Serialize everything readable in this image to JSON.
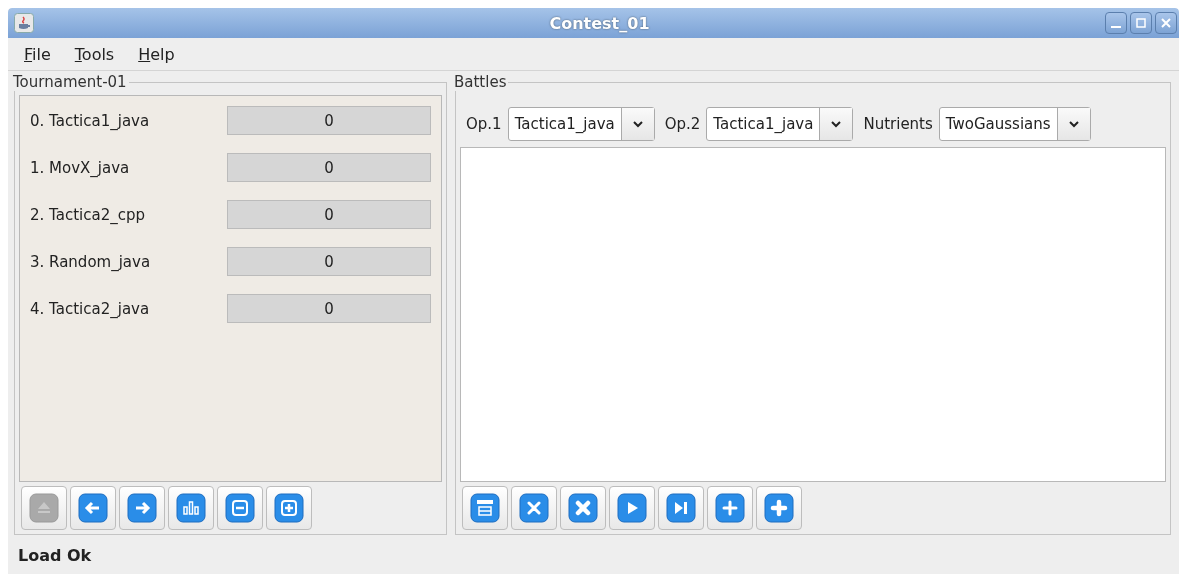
{
  "window": {
    "title": "Contest_01"
  },
  "menu": [
    {
      "label": "File",
      "underline_first": true
    },
    {
      "label": "Tools",
      "underline_first": true
    },
    {
      "label": "Help",
      "underline_first": true
    }
  ],
  "tournament": {
    "title": "Tournament-01",
    "entries": [
      {
        "name": "0. Tactica1_java",
        "score": "0"
      },
      {
        "name": "1. MovX_java",
        "score": "0"
      },
      {
        "name": "2. Tactica2_cpp",
        "score": "0"
      },
      {
        "name": "3. Random_java",
        "score": "0"
      },
      {
        "name": "4. Tactica2_java",
        "score": "0"
      }
    ],
    "toolbar": [
      {
        "kind": "eject",
        "disabled": true
      },
      {
        "kind": "left",
        "disabled": false
      },
      {
        "kind": "right",
        "disabled": false
      },
      {
        "kind": "bars",
        "disabled": false
      },
      {
        "kind": "minus",
        "disabled": false
      },
      {
        "kind": "plus-box",
        "disabled": false
      }
    ]
  },
  "battles": {
    "title": "Battles",
    "selectors": [
      {
        "label": "Op.1",
        "value": "Tactica1_java"
      },
      {
        "label": "Op.2",
        "value": "Tactica1_java"
      },
      {
        "label": "Nutrients",
        "value": "TwoGaussians"
      }
    ],
    "toolbar": [
      {
        "kind": "save",
        "disabled": false
      },
      {
        "kind": "x",
        "disabled": false
      },
      {
        "kind": "x-bold",
        "disabled": false
      },
      {
        "kind": "play",
        "disabled": false
      },
      {
        "kind": "step",
        "disabled": false
      },
      {
        "kind": "plus",
        "disabled": false
      },
      {
        "kind": "plus-bold",
        "disabled": false
      }
    ]
  },
  "status_bar": {
    "text": "Load Ok"
  }
}
